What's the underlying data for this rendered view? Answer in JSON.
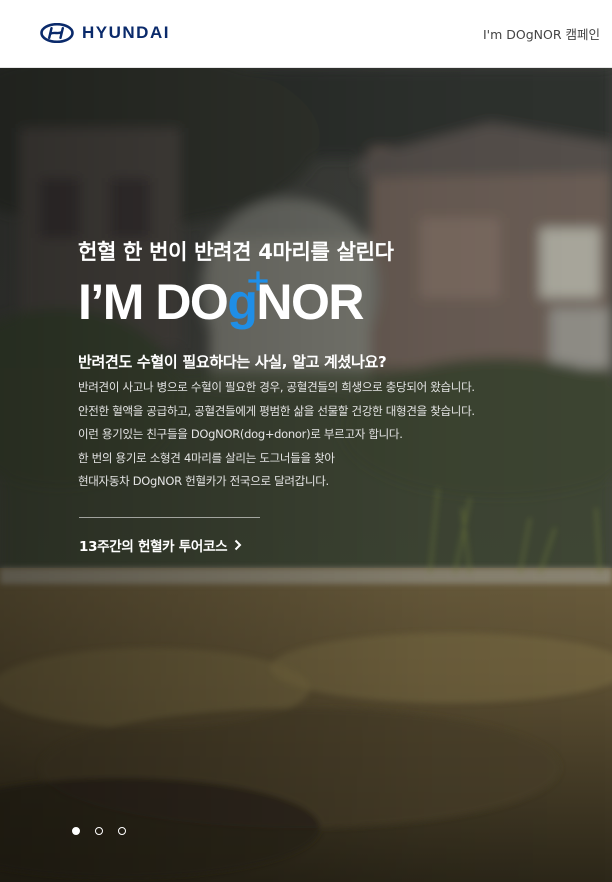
{
  "header": {
    "logo_text": "HYUNDAI",
    "logo_icon": "hyundai-logo-icon",
    "campaign_link": "I'm DOgNOR 캠페인"
  },
  "hero": {
    "headline": "헌혈 한 번이 반려견 4마리를 살린다",
    "brand_title": {
      "part1": "I’M DO",
      "highlight": "g",
      "part2": "NOR",
      "highlight_color": "#1f8ee6"
    },
    "subheading": "반려견도 수혈이 필요하다는 사실, 알고 계셨나요?",
    "body_lines": [
      "반려견이 사고나 병으로 수혈이 필요한 경우, 공혈견들의 희생으로 충당되어 왔습니다.",
      "안전한 혈액을 공급하고, 공혈견들에게 평범한 삶을 선물할 건강한 대형견을 찾습니다.",
      "이런 용기있는 친구들을 DOgNOR(dog+donor)로 부르고자 합니다.",
      "한 번의 용기로 소형견 4마리를 살리는 도그너들을 찾아",
      "현대자동차 DOgNOR 헌혈카가 전국으로 달려갑니다."
    ],
    "cta_label": "13주간의 헌혈카 투어코스",
    "cta_icon": "chevron-right-icon",
    "slides": {
      "total": 3,
      "active": 1
    }
  },
  "colors": {
    "brand_navy": "#0a2a6b",
    "accent_blue": "#1f8ee6"
  }
}
